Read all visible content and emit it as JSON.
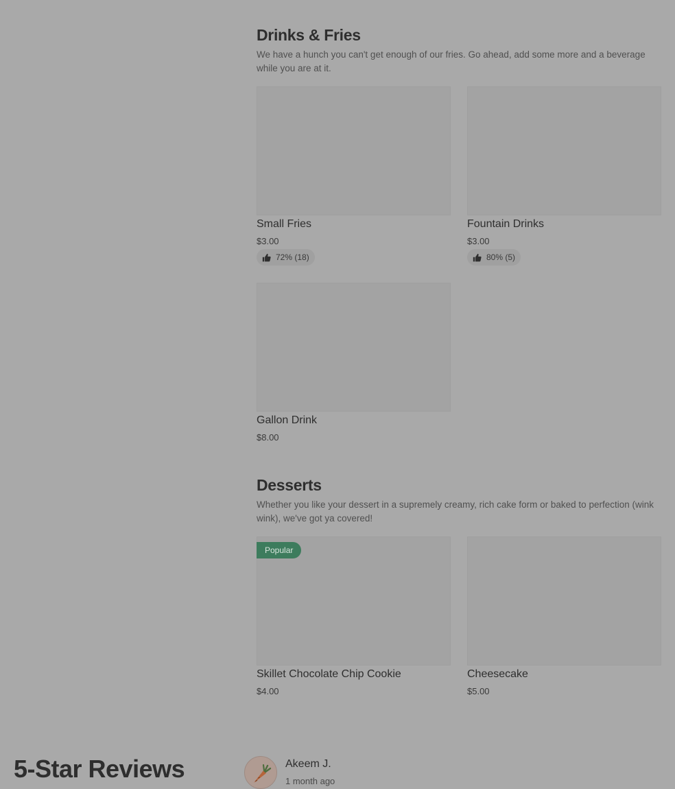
{
  "sections": [
    {
      "title": "Drinks & Fries",
      "description": "We have a hunch you can't get enough of our fries. Go ahead, add some more and a beverage while you are at it.",
      "items": [
        {
          "name": "Small Fries",
          "price": "$3.00",
          "rating": "72% (18)"
        },
        {
          "name": "Fountain Drinks",
          "price": "$3.00",
          "rating": "80% (5)"
        },
        {
          "name": "Gallon Drink",
          "price": "$8.00"
        }
      ]
    },
    {
      "title": "Desserts",
      "description": "Whether you like your dessert in a supremely creamy, rich cake form or baked to perfection (wink wink), we've got ya covered!",
      "items": [
        {
          "name": "Skillet Chocolate Chip Cookie",
          "price": "$4.00",
          "badge": "Popular"
        },
        {
          "name": "Cheesecake",
          "price": "$5.00"
        }
      ]
    }
  ],
  "reviews": {
    "heading": "5-Star Reviews",
    "items": [
      {
        "author": "Akeem J.",
        "time": "1 month ago",
        "avatar_icon": "carrot-icon"
      }
    ]
  },
  "colors": {
    "overlay_background": "#a9a9a9",
    "popular_badge": "#3d7c5d"
  },
  "icons": {
    "rating": "thumbs-up-icon"
  }
}
